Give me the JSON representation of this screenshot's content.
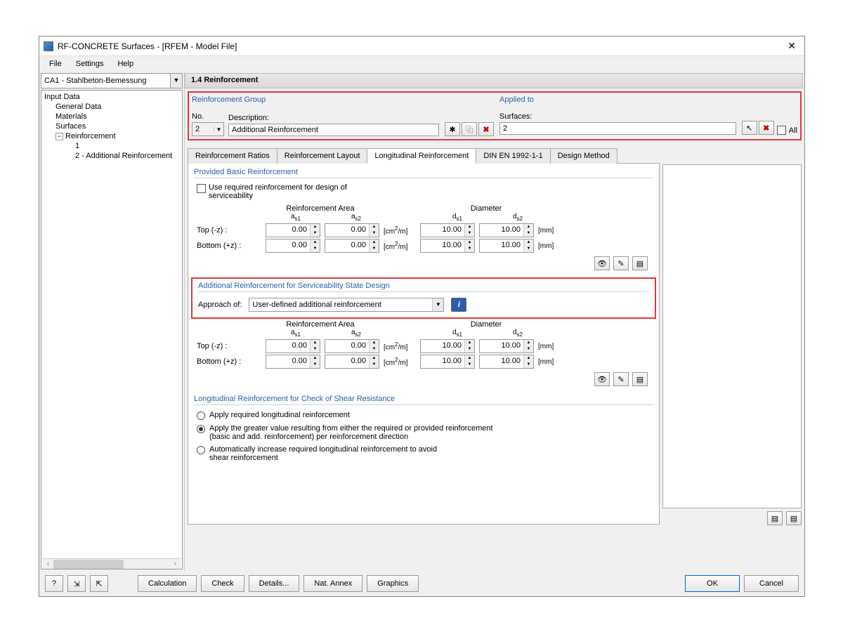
{
  "window": {
    "title": "RF-CONCRETE Surfaces - [RFEM - Model File]"
  },
  "menu": {
    "file": "File",
    "settings": "Settings",
    "help": "Help"
  },
  "combo": {
    "value": "CA1 - Stahlbeton-Bemessung"
  },
  "tree": {
    "root": "Input Data",
    "n1": "General Data",
    "n2": "Materials",
    "n3": "Surfaces",
    "n4": "Reinforcement",
    "n4a": "1",
    "n4b": "2 - Additional Reinforcement"
  },
  "page": {
    "title": "1.4 Reinforcement"
  },
  "group": {
    "title": "Reinforcement Group",
    "no_label": "No.",
    "no_value": "2",
    "desc_label": "Description:",
    "desc_value": "Additional Reinforcement"
  },
  "applied": {
    "title": "Applied to",
    "surf_label": "Surfaces:",
    "surf_value": "2",
    "all": "All"
  },
  "tabs": {
    "t1": "Reinforcement Ratios",
    "t2": "Reinforcement Layout",
    "t3": "Longitudinal Reinforcement",
    "t4": "DIN EN 1992-1-1",
    "t5": "Design Method"
  },
  "basic": {
    "title": "Provided Basic Reinforcement",
    "chk": "Use required reinforcement for design of serviceability",
    "ra": "Reinforcement Area",
    "dia": "Diameter",
    "as1": "a",
    "as1s": "s1",
    "as2": "a",
    "as2s": "s2",
    "ds1": "d",
    "ds1s": "s1",
    "ds2": "d",
    "ds2s": "s2",
    "top": "Top (-z) :",
    "bot": "Bottom (+z) :",
    "v": "0.00",
    "vd": "10.00",
    "u1": "[cm²/m]",
    "u2": "[mm]"
  },
  "add": {
    "title": "Additional Reinforcement for Serviceability State Design",
    "approach": "Approach of:",
    "sel": "User-defined additional reinforcement"
  },
  "shear": {
    "title": "Longitudinal Reinforcement for Check of Shear Resistance",
    "r1": "Apply required longitudinal reinforcement",
    "r2": "Apply the greater value resulting from either the required or provided reinforcement (basic and add. reinforcement) per reinforcement direction",
    "r3": "Automatically increase required longitudinal reinforcement to avoid shear reinforcement"
  },
  "footer": {
    "calc": "Calculation",
    "check": "Check",
    "details": "Details...",
    "annex": "Nat. Annex",
    "graphics": "Graphics",
    "ok": "OK",
    "cancel": "Cancel"
  }
}
